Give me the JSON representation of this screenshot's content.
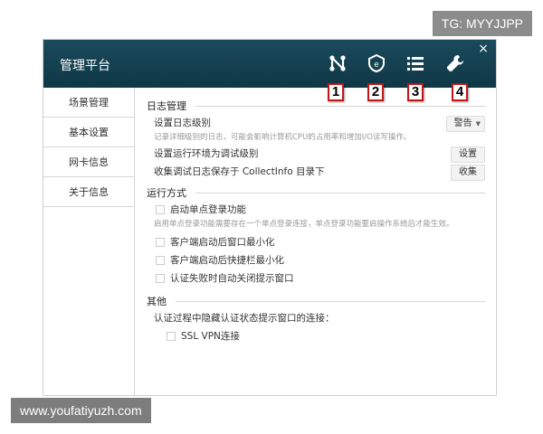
{
  "tg_badge": "TG: MYYJJPP",
  "watermark": "www.youfatiyuzh.com",
  "window": {
    "title": "管理平台",
    "close": "×",
    "badges": [
      "1",
      "2",
      "3",
      "4"
    ]
  },
  "sidebar": {
    "items": [
      {
        "label": "场景管理"
      },
      {
        "label": "基本设置"
      },
      {
        "label": "网卡信息"
      },
      {
        "label": "关于信息"
      }
    ]
  },
  "log": {
    "title": "日志管理",
    "level_label": "设置日志级别",
    "level_value": "警告",
    "level_desc": "记录详细级别的日志，可能会影响计算机CPU的占用率和增加I/O读写操作。",
    "debug_label": "设置运行环境为调试级别",
    "debug_button": "设置",
    "collect_label": "收集调试日志保存于 CollectInfo 目录下",
    "collect_button": "收集"
  },
  "run": {
    "title": "运行方式",
    "sso_label": "启动单点登录功能",
    "sso_desc": "启用单点登录功能需要存在一个单点登录连接，单点登录功能要启操作系统后才能生效。",
    "min_window_label": "客户端启动后窗口最小化",
    "min_taskbar_label": "客户端启动后快捷栏最小化",
    "auto_close_label": "认证失败时自动关闭提示窗口"
  },
  "other": {
    "title": "其他",
    "hide_label": "认证过程中隐藏认证状态提示窗口的连接：",
    "ssl_label": "SSL VPN连接"
  },
  "colors": {
    "titlebar": "#14414f",
    "badge_border": "#c01818"
  }
}
